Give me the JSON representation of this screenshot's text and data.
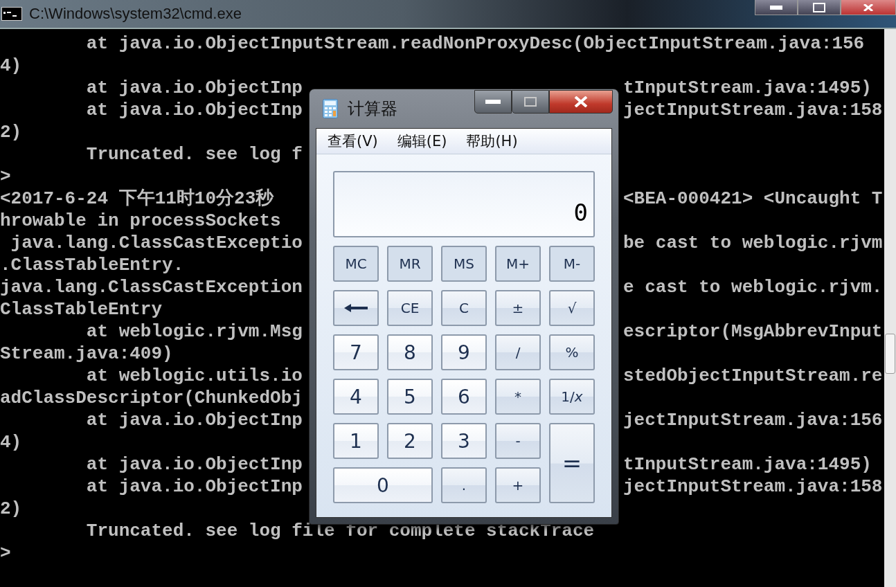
{
  "console_window": {
    "title": "C:\\Windows\\system32\\cmd.exe"
  },
  "console_lines": [
    {
      "left": "        at java.io.ObjectInputStream.readNonProxyDesc(ObjectInputStream.java:156"
    },
    {
      "left": "4)"
    },
    {
      "left": "        at java.io.ObjectInp",
      "right": "tInputStream.java:1495)"
    },
    {
      "left": "        at java.io.ObjectInp",
      "right": "jectInputStream.java:158"
    },
    {
      "left": "2)"
    },
    {
      "left": "        Truncated. see log f"
    },
    {
      "left": ">"
    },
    {
      "left": "<2017-6-24 下午11时10分23秒",
      "right": "<BEA-000421> <Uncaught T"
    },
    {
      "left": "hrowable in processSockets"
    },
    {
      "left": " java.lang.ClassCastExceptio",
      "right": "be cast to weblogic.rjvm"
    },
    {
      "left": ".ClassTableEntry."
    },
    {
      "left": "java.lang.ClassCastException",
      "right": "e cast to weblogic.rjvm."
    },
    {
      "left": "ClassTableEntry"
    },
    {
      "left": "        at weblogic.rjvm.Msg",
      "right": "escriptor(MsgAbbrevInput"
    },
    {
      "left": "Stream.java:409)"
    },
    {
      "left": "        at weblogic.utils.io",
      "right": "stedObjectInputStream.re"
    },
    {
      "left": "adClassDescriptor(ChunkedObj"
    },
    {
      "left": "        at java.io.ObjectInp",
      "right": "jectInputStream.java:156"
    },
    {
      "left": "4)"
    },
    {
      "left": "        at java.io.ObjectInp",
      "right": "tInputStream.java:1495)"
    },
    {
      "left": "        at java.io.ObjectInp",
      "right": "jectInputStream.java:158"
    },
    {
      "left": "2)"
    },
    {
      "left": "        Truncated. see log file for complete stackTrace"
    },
    {
      "left": ">"
    }
  ],
  "calculator": {
    "title": "计算器",
    "menu": [
      "查看(V)",
      "编辑(E)",
      "帮助(H)"
    ],
    "display": "0",
    "keys": [
      {
        "kind": "memory",
        "label": "MC"
      },
      {
        "kind": "memory",
        "label": "MR"
      },
      {
        "kind": "memory",
        "label": "MS"
      },
      {
        "kind": "memory",
        "label": "M+"
      },
      {
        "kind": "memory",
        "label": "M-"
      },
      {
        "kind": "backspace"
      },
      {
        "kind": "function",
        "label": "CE"
      },
      {
        "kind": "function",
        "label": "C"
      },
      {
        "kind": "function",
        "label": "±"
      },
      {
        "kind": "function",
        "label": "√"
      },
      {
        "kind": "digit",
        "label": "7"
      },
      {
        "kind": "digit",
        "label": "8"
      },
      {
        "kind": "digit",
        "label": "9"
      },
      {
        "kind": "function",
        "label": "/"
      },
      {
        "kind": "function",
        "label": "%"
      },
      {
        "kind": "digit",
        "label": "4"
      },
      {
        "kind": "digit",
        "label": "5"
      },
      {
        "kind": "digit",
        "label": "6"
      },
      {
        "kind": "function",
        "label": "*"
      },
      {
        "kind": "function",
        "label": "1/*x*"
      },
      {
        "kind": "digit",
        "label": "1"
      },
      {
        "kind": "digit",
        "label": "2"
      },
      {
        "kind": "digit",
        "label": "3"
      },
      {
        "kind": "function",
        "label": "-"
      },
      {
        "kind": "equals",
        "label": "="
      },
      {
        "kind": "zero",
        "label": "0"
      },
      {
        "kind": "function",
        "label": "."
      },
      {
        "kind": "function",
        "label": "+"
      }
    ]
  }
}
